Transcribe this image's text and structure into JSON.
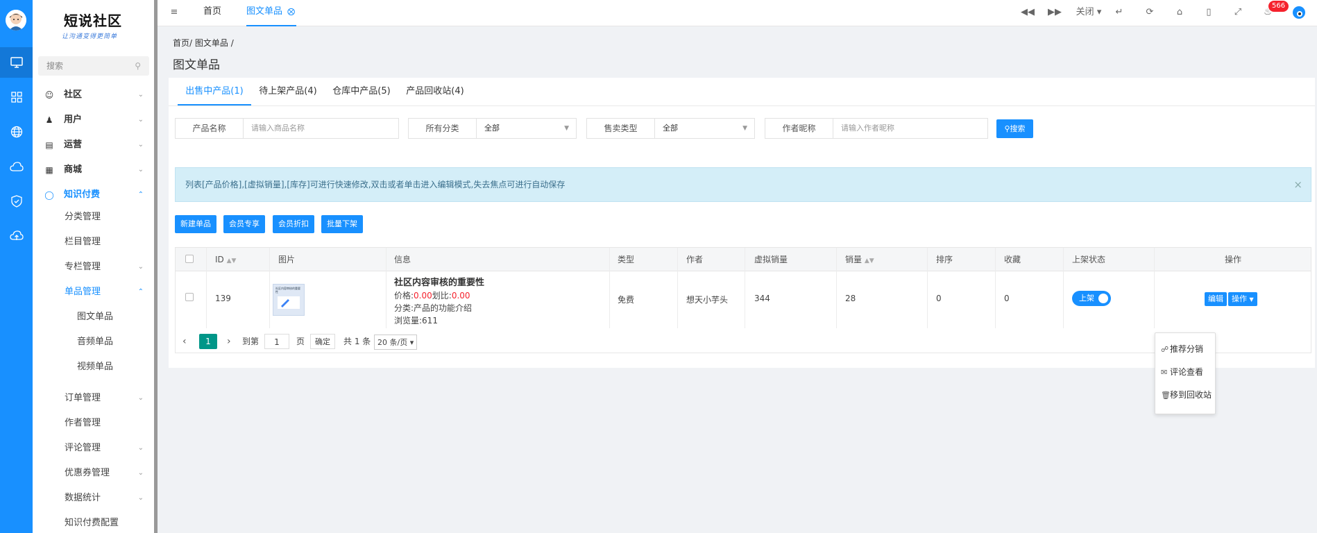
{
  "brand": {
    "title": "短说社区",
    "slogan": "让沟通变得更简单",
    "accent": "#1890ff"
  },
  "rail": {
    "icons": [
      "monitor-icon",
      "grid-icon",
      "globe-icon",
      "cloud-icon",
      "shield-icon",
      "cloud-upload-icon"
    ]
  },
  "sidebar": {
    "search_placeholder": "搜索",
    "menu": [
      {
        "label": "社区",
        "icon": "community-icon"
      },
      {
        "label": "用户",
        "icon": "user-icon"
      },
      {
        "label": "运营",
        "icon": "operation-icon"
      },
      {
        "label": "商城",
        "icon": "store-icon"
      },
      {
        "label": "知识付费",
        "icon": "bulb-icon"
      }
    ],
    "sub": [
      {
        "label": "分类管理"
      },
      {
        "label": "栏目管理"
      },
      {
        "label": "专栏管理"
      },
      {
        "label": "单品管理"
      },
      {
        "label": "图文单品"
      },
      {
        "label": "音频单品"
      },
      {
        "label": "视频单品"
      },
      {
        "label": "订单管理"
      },
      {
        "label": "作者管理"
      },
      {
        "label": "评论管理"
      },
      {
        "label": "优惠券管理"
      },
      {
        "label": "数据统计"
      },
      {
        "label": "知识付费配置"
      }
    ]
  },
  "topbar": {
    "tabs": [
      {
        "label": "首页"
      },
      {
        "label": "图文单品"
      }
    ],
    "close_label": "关闭",
    "badge": "566"
  },
  "breadcrumb": {
    "home": "首页",
    "sep1": "/",
    "current": "图文单品",
    "sep2": "/"
  },
  "page_title": "图文单品",
  "tabs": [
    {
      "label": "出售中产品(1)"
    },
    {
      "label": "待上架产品(4)"
    },
    {
      "label": "仓库中产品(5)"
    },
    {
      "label": "产品回收站(4)"
    }
  ],
  "filters": {
    "name_label": "产品名称",
    "name_placeholder": "请输入商品名称",
    "cat_label": "所有分类",
    "cat_value": "全部",
    "sale_label": "售卖类型",
    "sale_value": "全部",
    "author_label": "作者昵称",
    "author_placeholder": "请输入作者昵称",
    "search_button": "搜索"
  },
  "alert": {
    "text": "列表[产品价格],[虚拟销量],[库存]可进行快速修改,双击或者单击进入编辑模式,失去焦点可进行自动保存",
    "close": "×"
  },
  "actions": {
    "new": "新建单品",
    "member_only": "会员专享",
    "member_discount": "会员折扣",
    "batch_off": "批量下架"
  },
  "table": {
    "headers": {
      "id": "ID",
      "image": "图片",
      "info": "信息",
      "type": "类型",
      "author": "作者",
      "virtual_sales": "虚拟销量",
      "sales": "销量",
      "sort": "排序",
      "favorite": "收藏",
      "status": "上架状态",
      "ops": "操作"
    },
    "rows": [
      {
        "id": "139",
        "thumb_caption": "社区内容审核的重要性",
        "title": "社区内容审核的重要性",
        "price_label": "价格:",
        "price": "0.00",
        "ratio_label": "划比:",
        "ratio": "0.00",
        "category": "分类:产品的功能介绍",
        "views": "浏览量:611",
        "type": "免费",
        "author": "想天小芋头",
        "virtual_sales": "344",
        "sales": "28",
        "sort": "0",
        "favorite": "0",
        "status": "上架",
        "edit": "编辑",
        "ops": "操作"
      }
    ]
  },
  "pager": {
    "current": "1",
    "goto": "到第",
    "page_value": "1",
    "page_unit": "页",
    "confirm": "确定",
    "total": "共 1 条",
    "per_page": "20 条/页"
  },
  "dropdown": {
    "items": [
      {
        "label": "推荐分销",
        "icon": "share-icon"
      },
      {
        "label": "评论查看",
        "icon": "comment-icon"
      },
      {
        "label": "移到回收站",
        "icon": "trash-icon"
      }
    ]
  }
}
